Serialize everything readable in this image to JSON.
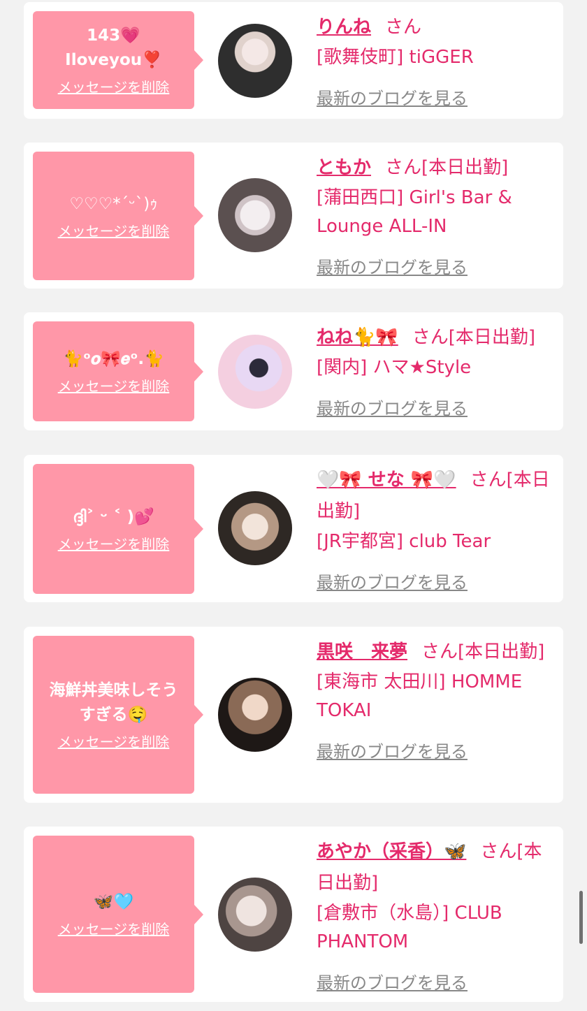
{
  "common": {
    "delete_label": "メッセージを削除",
    "blog_label": "最新のブログを見る",
    "san_label": "さん"
  },
  "cards": [
    {
      "message": "143💗\nIloveyou❣️",
      "name": "りんね",
      "status": "",
      "shop": "[歌舞伎町] tiGGER",
      "avatar_colors": [
        "#d8d8d8",
        "#3a3a3a"
      ]
    },
    {
      "message": "♡♡♡*´ᵕ`)ｩ",
      "name": "ともか",
      "status": "[本日出勤]",
      "shop": "[蒲田西口] Girl's Bar & Lounge ALL-IN",
      "avatar_colors": [
        "#efe6e8",
        "#7a6b6b"
      ]
    },
    {
      "message": "🐈ᵒ𝒐🎀𝒆ᵒ.🐈",
      "name": "ねね🐈🎀",
      "status": "[本日出勤]",
      "shop": "[関内] ハマ★Style",
      "avatar_colors": [
        "#f6d4e2",
        "#b8a4d8"
      ]
    },
    {
      "message": "ദ്ദി˃ ᵕ ˂ )💕",
      "name": "🤍🎀 せな 🎀🤍",
      "status": "[本日出勤]",
      "shop": "[JR宇都宮] club Tear",
      "avatar_colors": [
        "#c8b6a6",
        "#3c3430"
      ]
    },
    {
      "message": "海鮮丼美味しそう\nすぎる🤤",
      "name": "黒咲　来夢",
      "status": "[本日出勤]",
      "shop": "[東海市 太田川] HOMME TOKAI",
      "avatar_colors": [
        "#8a6a56",
        "#1e1816"
      ]
    },
    {
      "message": "🦋🩵",
      "name": "あやか（采香）🦋",
      "status": "[本日出勤]",
      "shop": "[倉敷市（水島）] CLUB PHANTOM",
      "avatar_colors": [
        "#cfc2bc",
        "#4e4442"
      ]
    }
  ]
}
